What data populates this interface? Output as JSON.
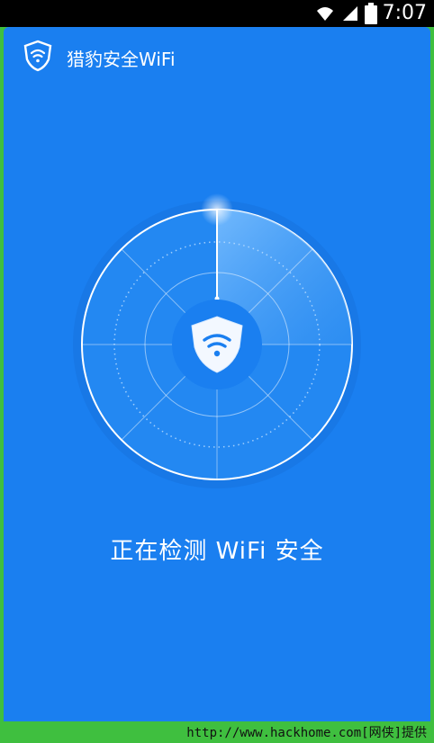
{
  "status_bar": {
    "time": "7:07"
  },
  "app": {
    "title": "猎豹安全WiFi"
  },
  "main": {
    "scan_status": "正在检测 WiFi 安全"
  },
  "footer": {
    "watermark": "http://www.hackhome.com[网侠]提供"
  },
  "colors": {
    "background": "#1a7ff0",
    "frame_green": "#3fbf3f",
    "white": "#ffffff"
  },
  "icons": {
    "wifi": "wifi-icon",
    "signal": "signal-icon",
    "battery": "battery-icon",
    "shield": "shield-wifi-icon"
  }
}
